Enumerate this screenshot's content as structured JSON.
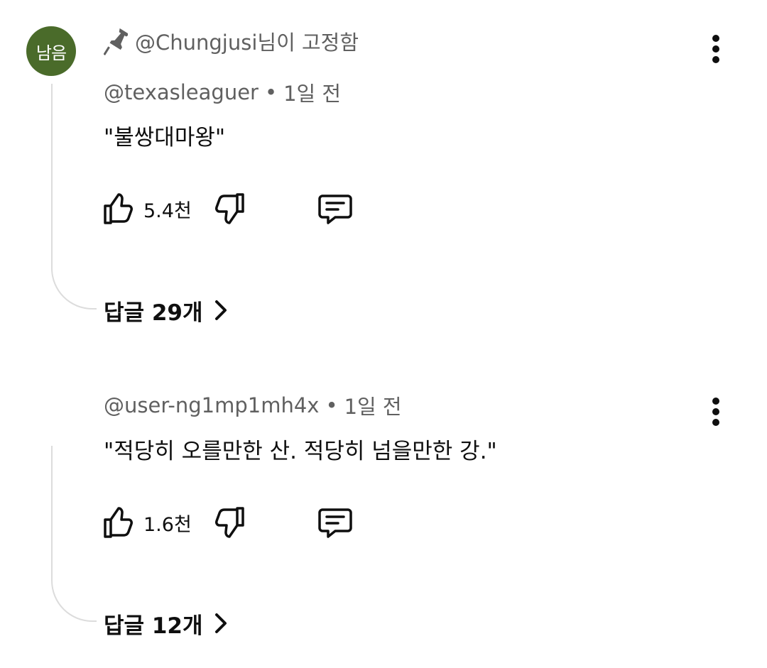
{
  "pinned_comment": {
    "avatar_text": "남음",
    "avatar_color": "#4a6b2a",
    "pinned_by": "@Chungjusi님이 고정함",
    "author": "@texasleaguer",
    "separator": "•",
    "time": "1일 전",
    "text": "\"불쌍대마왕\"",
    "likes": "5.4천",
    "replies_label": "답글 29개"
  },
  "second_comment": {
    "author": "@user-ng1mp1mh4x",
    "separator": "•",
    "time": "1일 전",
    "text": "\"적당히 오를만한 산. 적당히 넘을만한 강.\"",
    "likes": "1.6천",
    "replies_label": "답글 12개"
  },
  "icons": {
    "pin": "pin-icon",
    "more": "more-vert-icon",
    "like": "thumbs-up-icon",
    "dislike": "thumbs-down-icon",
    "reply": "reply-comment-icon",
    "chevron": "chevron-right-icon"
  }
}
